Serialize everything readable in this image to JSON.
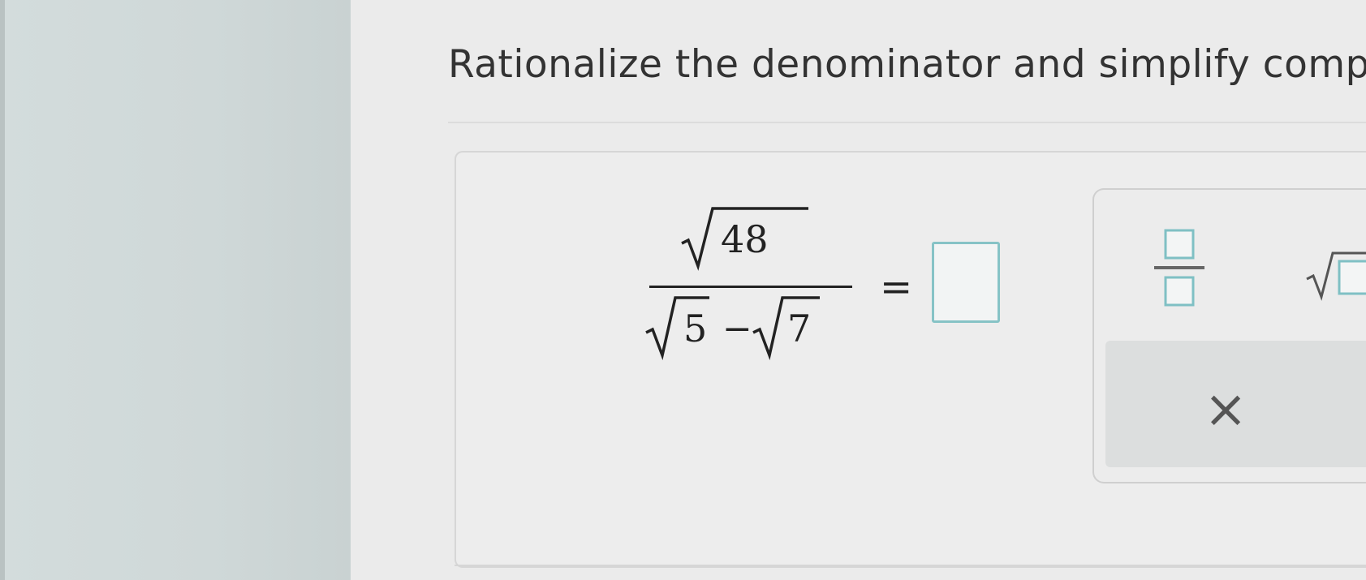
{
  "question": {
    "text": "Rationalize the denominator and simplify comp"
  },
  "expression": {
    "numerator_radicand": "48",
    "denominator_left_radicand": "5",
    "denominator_operator": "−",
    "denominator_right_radicand": "7",
    "equals": "="
  },
  "answer": {
    "value": ""
  },
  "palette": {
    "tools": [
      "fraction-tool",
      "sqrt-tool"
    ],
    "clear_label": "×"
  },
  "colors": {
    "answer_box_border": "#86c3c6",
    "tool_accent": "#7fc0c4",
    "text": "#222222"
  }
}
